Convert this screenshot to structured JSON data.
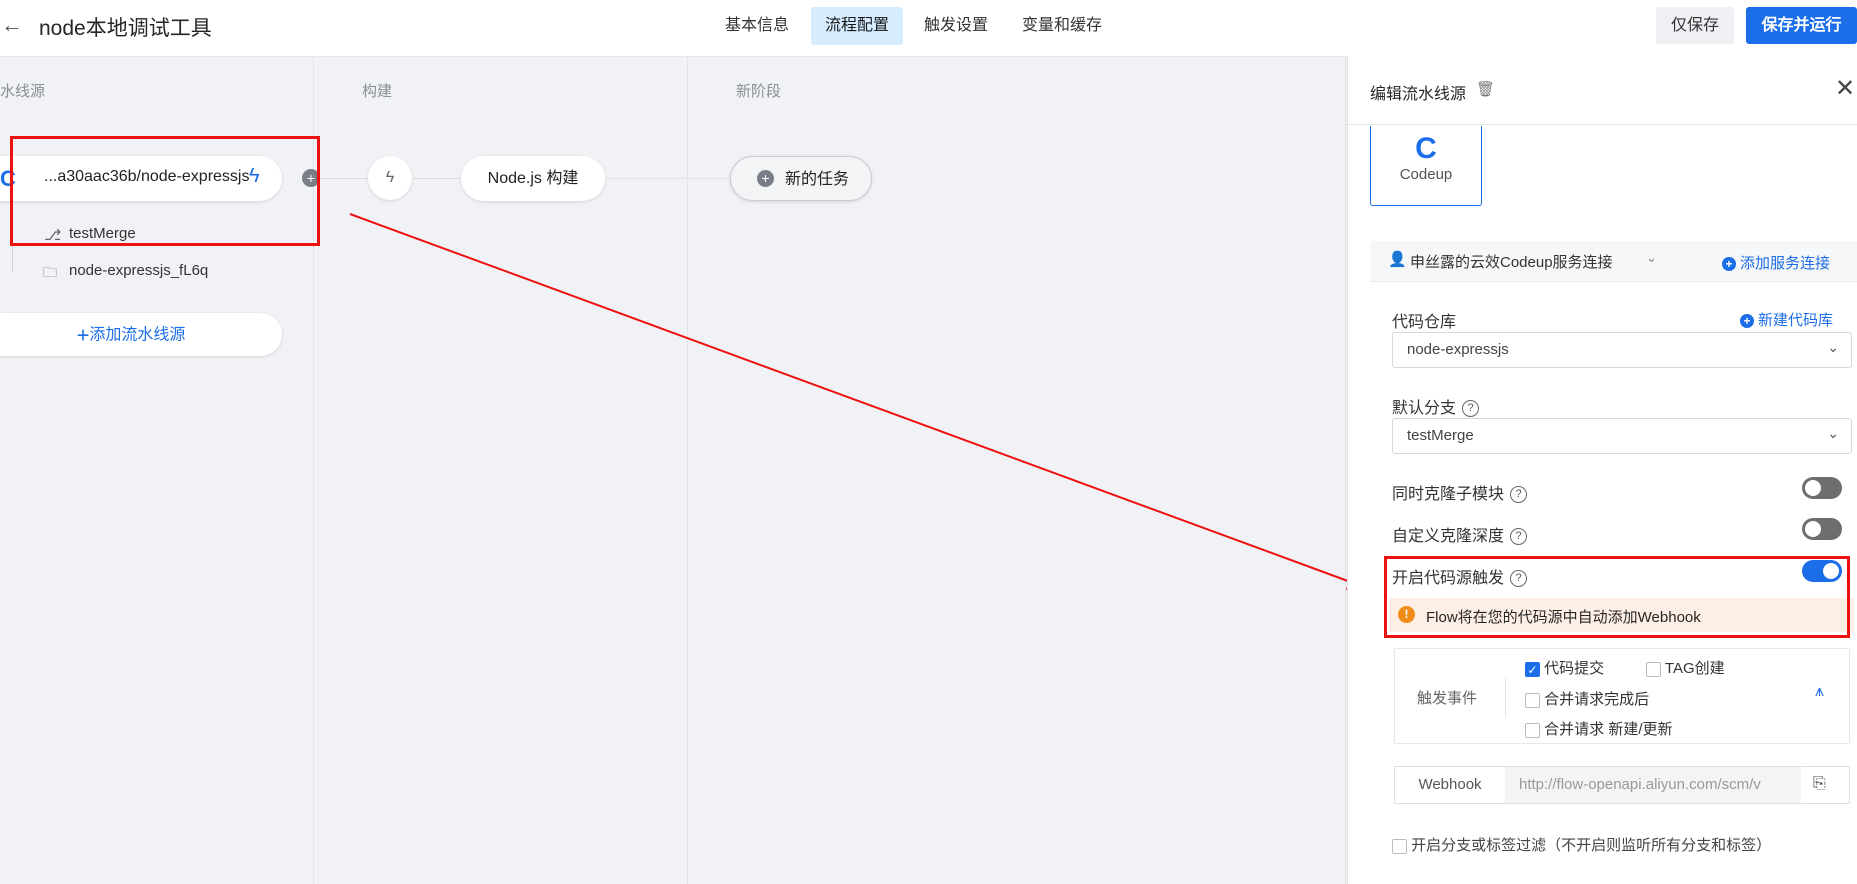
{
  "header": {
    "back_icon": "arrow-left-icon",
    "title": "node本地调试工具",
    "tabs": [
      {
        "label": "基本信息",
        "active": false
      },
      {
        "label": "流程配置",
        "active": true
      },
      {
        "label": "触发设置",
        "active": false
      },
      {
        "label": "变量和缓存",
        "active": false
      }
    ],
    "save_only_label": "仅保存",
    "save_run_label": "保存并运行"
  },
  "canvas": {
    "columns": [
      {
        "title": "水线源"
      },
      {
        "title": "构建"
      },
      {
        "title": "新阶段"
      }
    ],
    "source": {
      "repo_label": "...a30aac36b/node-expressjs",
      "branch": "testMerge",
      "folder": "node-expressjs_fL6q",
      "add_source_label": "添加流水线源"
    },
    "build_job_label": "Node.js 构建",
    "new_task_label": "新的任务"
  },
  "panel": {
    "title": "编辑流水线源",
    "codeup_card_label": "Codeup",
    "service_connection": "申丝露的云效Codeup服务连接",
    "add_connection_label": "添加服务连接",
    "repo_label": "代码仓库",
    "new_repo_label": "新建代码库",
    "repo_value": "node-expressjs",
    "branch_label": "默认分支",
    "branch_value": "testMerge",
    "clone_submodule_label": "同时克隆子模块",
    "custom_depth_label": "自定义克隆深度",
    "source_trigger_label": "开启代码源触发",
    "webhook_warning": "Flow将在您的代码源中自动添加Webhook",
    "trigger_events_label": "触发事件",
    "events": [
      {
        "label": "代码提交",
        "checked": true
      },
      {
        "label": "TAG创建",
        "checked": false
      },
      {
        "label": "合并请求完成后",
        "checked": false
      },
      {
        "label": "合并请求 新建/更新",
        "checked": false
      }
    ],
    "webhook_label": "Webhook",
    "webhook_url": "http://flow-openapi.aliyun.com/scm/v",
    "branch_filter_label": "开启分支或标签过滤（不开启则监听所有分支和标签）",
    "toggles": {
      "clone_submodule": false,
      "custom_depth": false,
      "source_trigger": true
    }
  },
  "colors": {
    "primary": "#1b6ee8",
    "highlight": "#e11111",
    "warning_bg": "#fdeee6",
    "warning_icon": "#f08c1a"
  }
}
